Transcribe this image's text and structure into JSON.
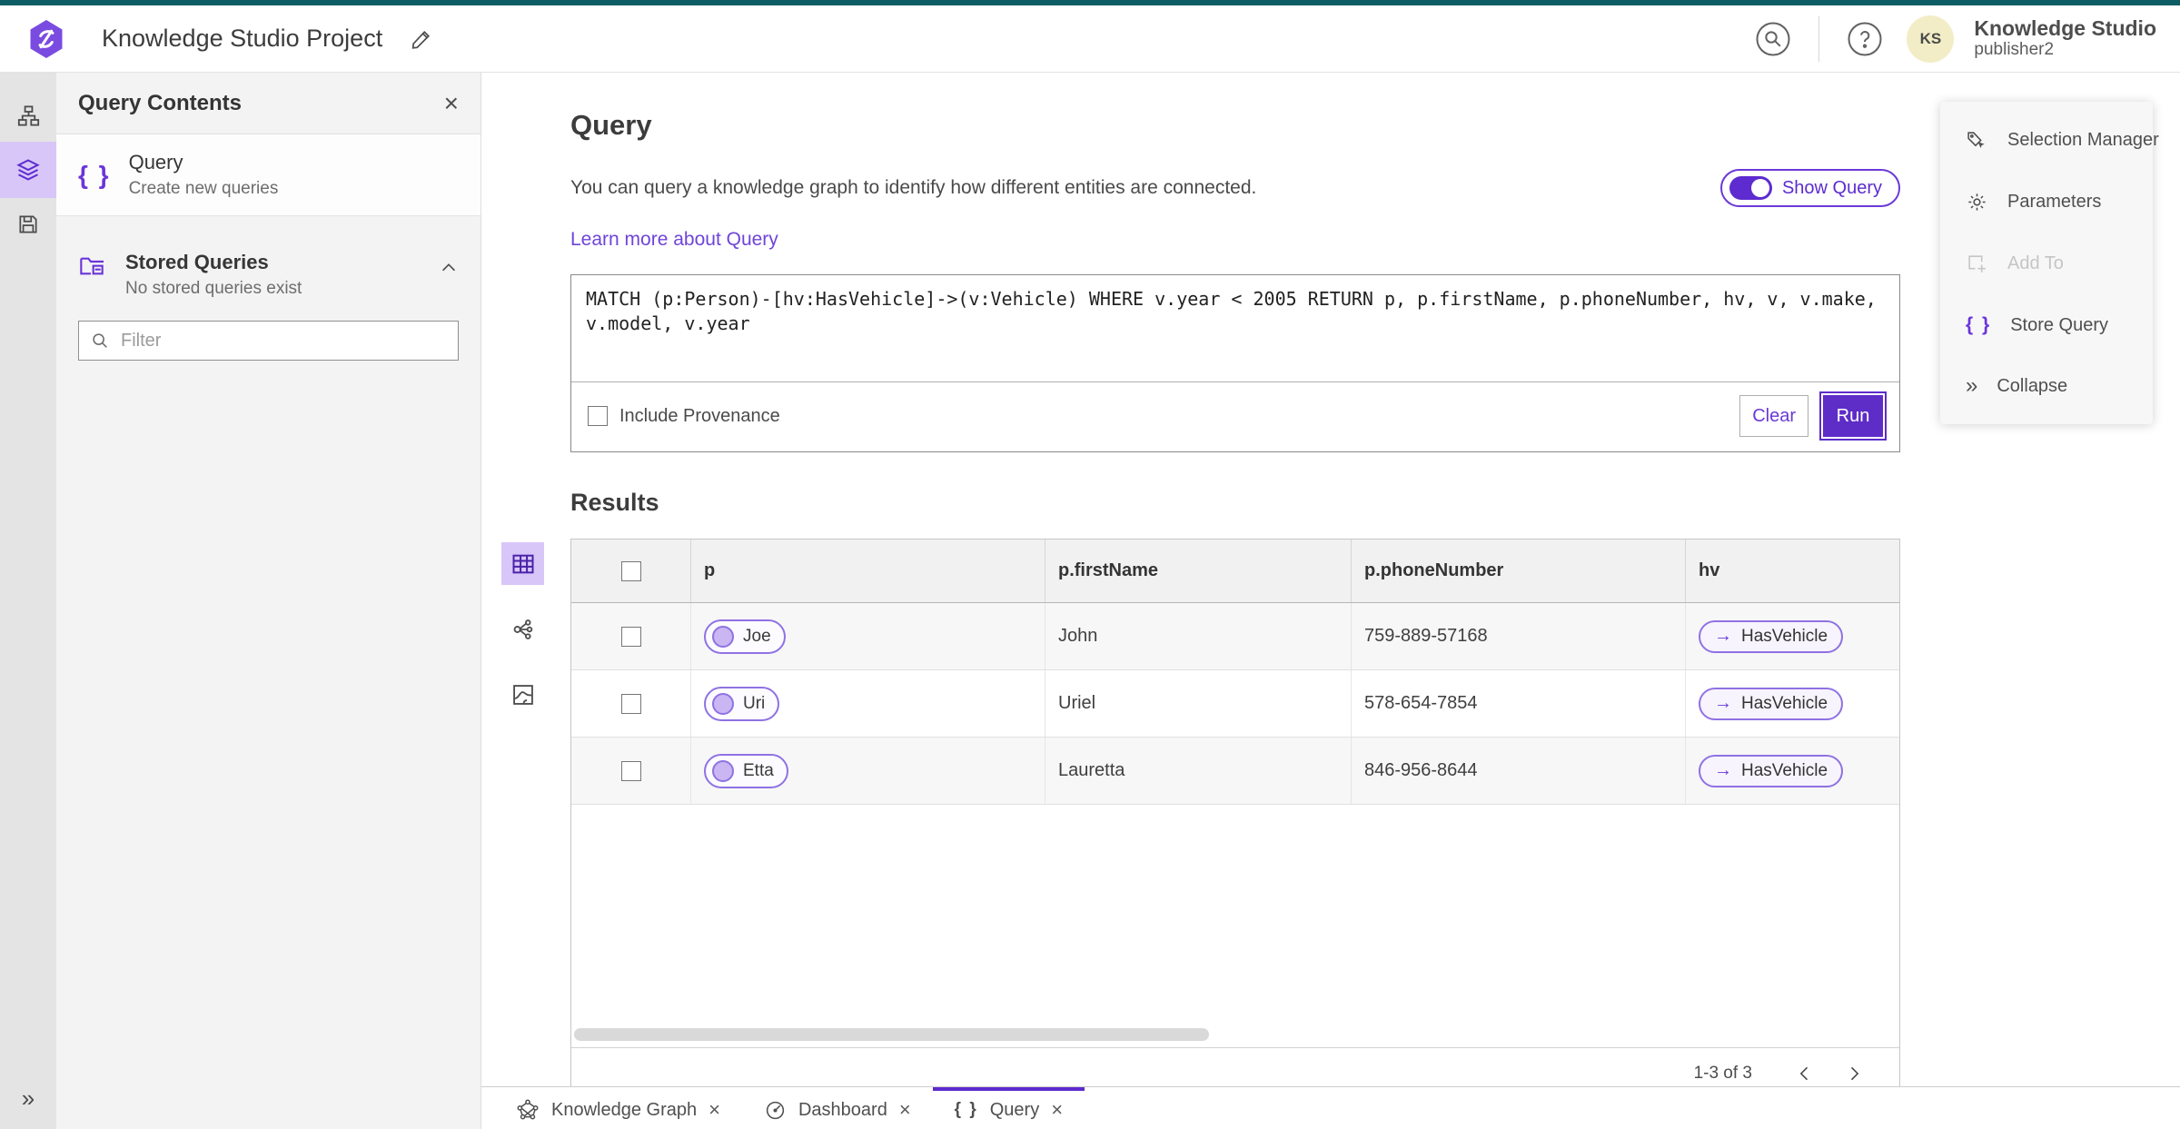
{
  "colors": {
    "accent": "#5e2cc7",
    "accent_light": "#d8c6f8",
    "top_strip": "#0d5c63",
    "link": "#6f44d9",
    "avatar_bg": "#f2edc6"
  },
  "icons": {
    "arrow_right": "→",
    "collapse_chevrons": "»",
    "expand_chevrons": "»",
    "curly_braces": "{ }",
    "close": "×"
  },
  "header": {
    "app_title": "Knowledge Studio Project",
    "user_name": "Knowledge Studio",
    "user_role": "publisher2",
    "avatar_initials": "KS"
  },
  "left_panel": {
    "title": "Query Contents",
    "query_item": {
      "title": "Query",
      "subtitle": "Create new queries"
    },
    "stored_queries": {
      "title": "Stored Queries",
      "subtitle": "No stored queries exist"
    },
    "filter_placeholder": "Filter"
  },
  "query_section": {
    "title": "Query",
    "description": "You can query a knowledge graph to identify how different entities are connected.",
    "learn_more": "Learn more about Query",
    "show_query_label": "Show Query",
    "query_text": "MATCH (p:Person)-[hv:HasVehicle]->(v:Vehicle) WHERE v.year < 2005 RETURN p, p.firstName, p.phoneNumber, hv, v, v.make, v.model, v.year",
    "include_provenance_label": "Include Provenance",
    "clear_label": "Clear",
    "run_label": "Run"
  },
  "results": {
    "title": "Results",
    "columns": [
      "p",
      "p.firstName",
      "p.phoneNumber",
      "hv"
    ],
    "rows": [
      {
        "entity": "Joe",
        "firstName": "John",
        "phoneNumber": "759-889-57168",
        "relationship": "HasVehicle"
      },
      {
        "entity": "Uri",
        "firstName": "Uriel",
        "phoneNumber": "578-654-7854",
        "relationship": "HasVehicle"
      },
      {
        "entity": "Etta",
        "firstName": "Lauretta",
        "phoneNumber": "846-956-8644",
        "relationship": "HasVehicle"
      }
    ],
    "pagination": "1-3 of 3"
  },
  "tools_panel": {
    "items": [
      {
        "label": "Selection Manager"
      },
      {
        "label": "Parameters"
      },
      {
        "label": "Add To"
      },
      {
        "label": "Store Query"
      },
      {
        "label": "Collapse"
      }
    ]
  },
  "tab_bar": {
    "tabs": [
      {
        "label": "Knowledge Graph"
      },
      {
        "label": "Dashboard"
      },
      {
        "label": "Query"
      }
    ]
  }
}
